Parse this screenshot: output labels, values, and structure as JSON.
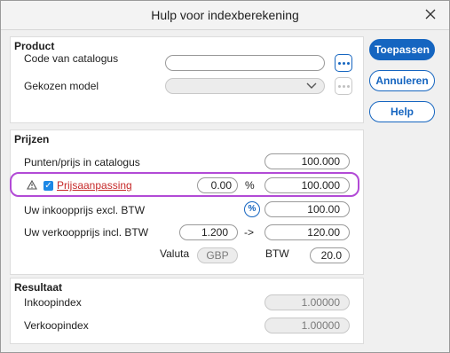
{
  "window": {
    "title": "Hulp voor indexberekening"
  },
  "product": {
    "title": "Product",
    "code_label": "Code van catalogus",
    "code_value": "",
    "model_label": "Gekozen model",
    "model_value": ""
  },
  "prices": {
    "title": "Prijzen",
    "catalog_points_label": "Punten/prijs in catalogus",
    "catalog_points_value": "100.000",
    "adjustment_label": "Prijsaanpassing",
    "adjustment_checked": true,
    "adjustment_percent": "0.00",
    "percent_sign": "%",
    "adjustment_value": "100.000",
    "purchase_label": "Uw inkoopprijs excl. BTW",
    "purchase_toggle": "%",
    "purchase_value": "100.00",
    "sale_label": "Uw verkoopprijs incl. BTW",
    "sale_factor": "1.200",
    "arrow": "->",
    "sale_value": "120.00",
    "currency_label": "Valuta",
    "currency_value": "GBP",
    "vat_label": "BTW",
    "vat_value": "20.0"
  },
  "result": {
    "title": "Resultaat",
    "purchase_index_label": "Inkoopindex",
    "purchase_index_value": "1.00000",
    "sale_index_label": "Verkoopindex",
    "sale_index_value": "1.00000"
  },
  "buttons": {
    "apply": "Toepassen",
    "cancel": "Annuleren",
    "help": "Help"
  },
  "colors": {
    "accent": "#1565c0",
    "highlight": "#b24ad6",
    "warning_text": "#c62828"
  }
}
